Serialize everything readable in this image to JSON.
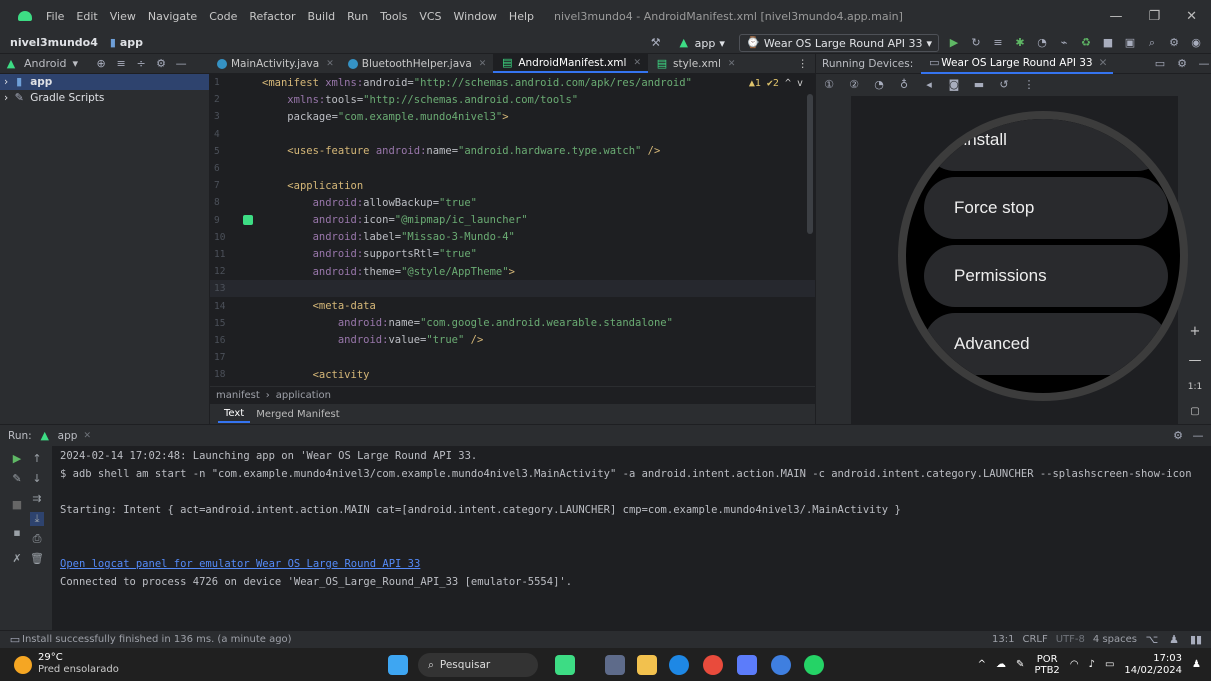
{
  "window": {
    "menu": [
      "File",
      "Edit",
      "View",
      "Navigate",
      "Code",
      "Refactor",
      "Build",
      "Run",
      "Tools",
      "VCS",
      "Window",
      "Help"
    ],
    "title": "nivel3mundo4 - AndroidManifest.xml [nivel3mundo4.app.main]",
    "controls": [
      "—",
      "❐",
      "✕"
    ]
  },
  "navbar": {
    "project": "nivel3mundo4",
    "module": "app",
    "run_config": "app",
    "device": "Wear OS Large Round API 33"
  },
  "project_panel": {
    "view": "Android",
    "items": [
      {
        "label": "app",
        "selected": true
      },
      {
        "label": "Gradle Scripts",
        "selected": false
      }
    ]
  },
  "tabs": [
    {
      "label": "MainActivity.java",
      "active": false
    },
    {
      "label": "BluetoothHelper.java",
      "active": false
    },
    {
      "label": "AndroidManifest.xml",
      "active": true
    },
    {
      "label": "style.xml",
      "active": false
    }
  ],
  "editor": {
    "inspections": "▲1  ✔2",
    "lines": [
      {
        "n": "1",
        "html": "<span class='tag'>&lt;manifest </span><span class='attrns'>xmlns:</span><span class='attr'>android</span>=<span class='val'>\"http://schemas.android.com/apk/res/android\"</span>"
      },
      {
        "n": "2",
        "html": "    <span class='attrns'>xmlns:</span><span class='attr'>tools</span>=<span class='val'>\"http://schemas.android.com/tools\"</span>"
      },
      {
        "n": "3",
        "html": "    <span class='attr'>package</span>=<span class='val'>\"com.example.mundo4nivel3\"</span><span class='tag'>&gt;</span>"
      },
      {
        "n": "4",
        "html": ""
      },
      {
        "n": "5",
        "html": "    <span class='tag'>&lt;uses-feature </span><span class='attrns'>android:</span><span class='attr'>name</span>=<span class='val'>\"android.hardware.type.watch\"</span><span class='tag'> /&gt;</span>"
      },
      {
        "n": "6",
        "html": ""
      },
      {
        "n": "7",
        "html": "    <span class='tag'>&lt;application</span>"
      },
      {
        "n": "8",
        "html": "        <span class='attrns'>android:</span><span class='attr'>allowBackup</span>=<span class='val'>\"true\"</span>"
      },
      {
        "n": "9",
        "html": "        <span class='attrns'>android:</span><span class='attr'>icon</span>=<span class='val'>\"@mipmap/ic_launcher\"</span>"
      },
      {
        "n": "10",
        "html": "        <span class='attrns'>android:</span><span class='attr'>label</span>=<span class='val'>\"Missao-3-Mundo-4\"</span>"
      },
      {
        "n": "11",
        "html": "        <span class='attrns'>android:</span><span class='attr'>supportsRtl</span>=<span class='val'>\"true\"</span>"
      },
      {
        "n": "12",
        "html": "        <span class='attrns'>android:</span><span class='attr'>theme</span>=<span class='val'>\"@style/AppTheme\"</span><span class='tag'>&gt;</span>"
      },
      {
        "n": "13",
        "html": ""
      },
      {
        "n": "14",
        "html": "        <span class='tag'>&lt;meta-data</span>"
      },
      {
        "n": "15",
        "html": "            <span class='attrns'>android:</span><span class='attr'>name</span>=<span class='val'>\"com.google.android.wearable.standalone\"</span>"
      },
      {
        "n": "16",
        "html": "            <span class='attrns'>android:</span><span class='attr'>value</span>=<span class='val'>\"true\"</span><span class='tag'> /&gt;</span>"
      },
      {
        "n": "17",
        "html": ""
      },
      {
        "n": "18",
        "html": "        <span class='tag'>&lt;activity</span>"
      }
    ],
    "breadcrumb": [
      "manifest",
      "application"
    ],
    "bottom_tabs": [
      "Text",
      "Merged Manifest"
    ]
  },
  "running_devices": {
    "label": "Running Devices:",
    "device_tab": "Wear OS Large Round API 33",
    "watch_items": [
      "ninstall",
      "Force stop",
      "Permissions",
      "Advanced"
    ],
    "zoom": [
      "+",
      "—",
      "1:1"
    ]
  },
  "run_panel": {
    "label": "Run:",
    "config": "app",
    "lines": [
      {
        "text": "2024-02-14 17:02:48: Launching app on 'Wear OS Large Round API 33.",
        "link": false
      },
      {
        "text": "$ adb shell am start -n \"com.example.mundo4nivel3/com.example.mundo4nivel3.MainActivity\" -a android.intent.action.MAIN -c android.intent.category.LAUNCHER --splashscreen-show-icon",
        "link": false
      },
      {
        "text": "",
        "link": false
      },
      {
        "text": "Starting: Intent { act=android.intent.action.MAIN cat=[android.intent.category.LAUNCHER] cmp=com.example.mundo4nivel3/.MainActivity }",
        "link": false
      },
      {
        "text": "",
        "link": false
      },
      {
        "text": "",
        "link": false
      },
      {
        "text": "Open logcat panel for emulator Wear OS Large Round API 33",
        "link": true
      },
      {
        "text": "Connected to process 4726 on device 'Wear_OS_Large_Round_API_33 [emulator-5554]'.",
        "link": false
      }
    ]
  },
  "status": {
    "message": "Install successfully finished in 136 ms. (a minute ago)",
    "position": "13:1",
    "line_sep": "CRLF",
    "encoding": "UTF-8",
    "indent": "4 spaces"
  },
  "taskbar": {
    "temp": "29°C",
    "weather": "Pred ensolarado",
    "search": "Pesquisar",
    "lang1": "POR",
    "lang2": "PTB2",
    "time": "17:03",
    "date": "14/02/2024"
  }
}
